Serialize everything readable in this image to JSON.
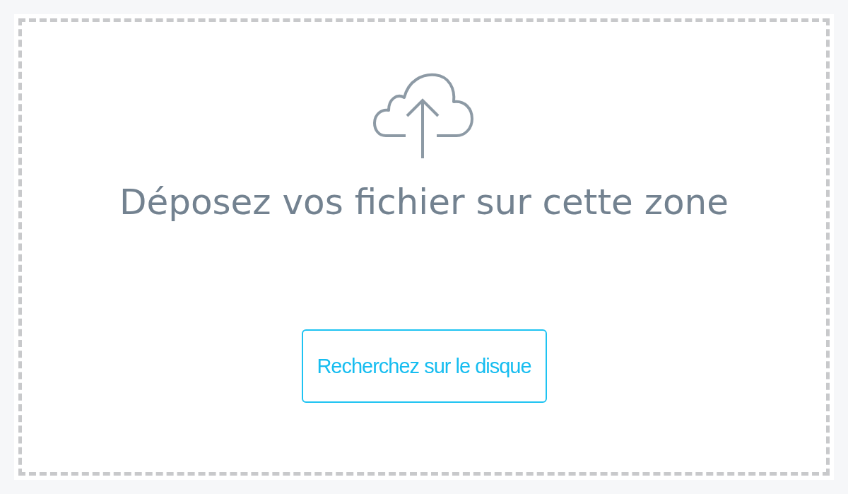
{
  "dropzone": {
    "heading": "Déposez vos fichier sur cette zone",
    "button": {
      "label": "Recherchez sur le disque"
    }
  }
}
